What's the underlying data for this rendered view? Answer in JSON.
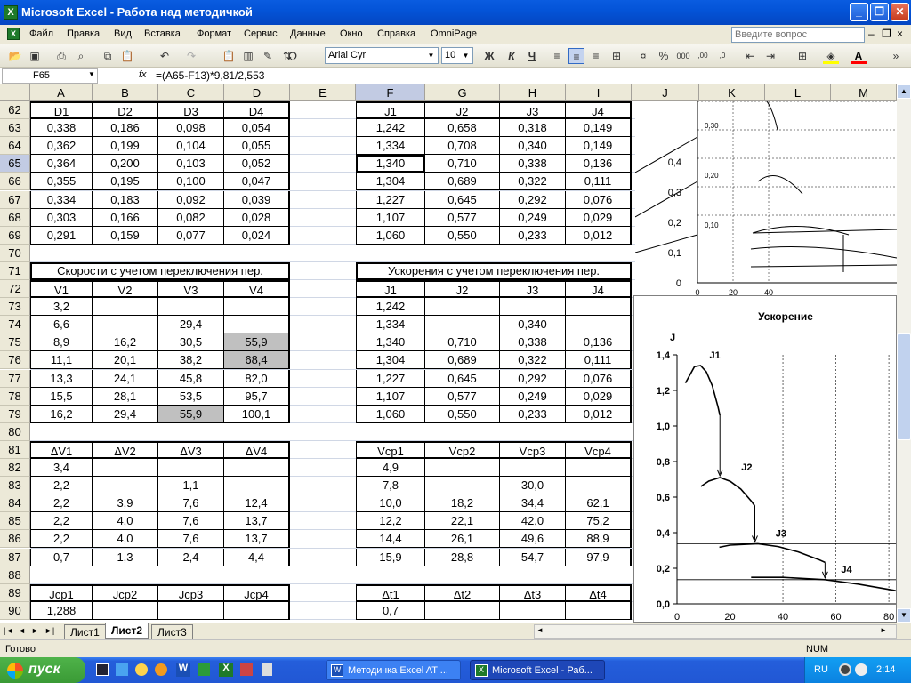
{
  "window": {
    "title": "Microsoft Excel - Работа над методичкой",
    "app_icon": "X"
  },
  "menu": [
    "Файл",
    "Правка",
    "Вид",
    "Вставка",
    "Формат",
    "Сервис",
    "Данные",
    "Окно",
    "Справка",
    "OmniPage"
  ],
  "help_box": {
    "placeholder": "Введите вопрос"
  },
  "toolbar": {
    "font": "Arial Cyr",
    "size": "10",
    "bold": "Ж",
    "italic": "К",
    "underline": "Ч"
  },
  "formula_bar": {
    "name_box": "F65",
    "fx": "fx",
    "formula": "=(A65-F13)*9,81/2,553"
  },
  "columns": [
    "A",
    "B",
    "C",
    "D",
    "E",
    "F",
    "G",
    "H",
    "I",
    "J",
    "K",
    "L",
    "M"
  ],
  "rows": {
    "r62": {
      "num": "62",
      "A": "D1",
      "B": "D2",
      "C": "D3",
      "D": "D4",
      "F": "J1",
      "G": "J2",
      "H": "J3",
      "I": "J4"
    },
    "r63": {
      "num": "63",
      "A": "0,338",
      "B": "0,186",
      "C": "0,098",
      "D": "0,054",
      "F": "1,242",
      "G": "0,658",
      "H": "0,318",
      "I": "0,149"
    },
    "r64": {
      "num": "64",
      "A": "0,362",
      "B": "0,199",
      "C": "0,104",
      "D": "0,055",
      "F": "1,334",
      "G": "0,708",
      "H": "0,340",
      "I": "0,149"
    },
    "r65": {
      "num": "65",
      "A": "0,364",
      "B": "0,200",
      "C": "0,103",
      "D": "0,052",
      "F": "1,340",
      "G": "0,710",
      "H": "0,338",
      "I": "0,136"
    },
    "r66": {
      "num": "66",
      "A": "0,355",
      "B": "0,195",
      "C": "0,100",
      "D": "0,047",
      "F": "1,304",
      "G": "0,689",
      "H": "0,322",
      "I": "0,111"
    },
    "r67": {
      "num": "67",
      "A": "0,334",
      "B": "0,183",
      "C": "0,092",
      "D": "0,039",
      "F": "1,227",
      "G": "0,645",
      "H": "0,292",
      "I": "0,076"
    },
    "r68": {
      "num": "68",
      "A": "0,303",
      "B": "0,166",
      "C": "0,082",
      "D": "0,028",
      "F": "1,107",
      "G": "0,577",
      "H": "0,249",
      "I": "0,029"
    },
    "r69": {
      "num": "69",
      "A": "0,291",
      "B": "0,159",
      "C": "0,077",
      "D": "0,024",
      "F": "1,060",
      "G": "0,550",
      "H": "0,233",
      "I": "0,012"
    },
    "r70": {
      "num": "70"
    },
    "r71": {
      "num": "71",
      "left": "Скорости с учетом переключения пер.",
      "right": "Ускорения с учетом переключения пер."
    },
    "r72": {
      "num": "72",
      "A": "V1",
      "B": "V2",
      "C": "V3",
      "D": "V4",
      "F": "J1",
      "G": "J2",
      "H": "J3",
      "I": "J4"
    },
    "r73": {
      "num": "73",
      "A": "3,2",
      "F": "1,242"
    },
    "r74": {
      "num": "74",
      "A": "6,6",
      "C": "29,4",
      "F": "1,334",
      "H": "0,340"
    },
    "r75": {
      "num": "75",
      "A": "8,9",
      "B": "16,2",
      "C": "30,5",
      "D": "55,9",
      "F": "1,340",
      "G": "0,710",
      "H": "0,338",
      "I": "0,136"
    },
    "r76": {
      "num": "76",
      "A": "11,1",
      "B": "20,1",
      "C": "38,2",
      "D": "68,4",
      "F": "1,304",
      "G": "0,689",
      "H": "0,322",
      "I": "0,111"
    },
    "r77": {
      "num": "77",
      "A": "13,3",
      "B": "24,1",
      "C": "45,8",
      "D": "82,0",
      "F": "1,227",
      "G": "0,645",
      "H": "0,292",
      "I": "0,076"
    },
    "r78": {
      "num": "78",
      "A": "15,5",
      "B": "28,1",
      "C": "53,5",
      "D": "95,7",
      "F": "1,107",
      "G": "0,577",
      "H": "0,249",
      "I": "0,029"
    },
    "r79": {
      "num": "79",
      "A": "16,2",
      "B": "29,4",
      "C": "55,9",
      "D": "100,1",
      "F": "1,060",
      "G": "0,550",
      "H": "0,233",
      "I": "0,012"
    },
    "r80": {
      "num": "80"
    },
    "r81": {
      "num": "81",
      "A": "ΔV1",
      "B": "ΔV2",
      "C": "ΔV3",
      "D": "ΔV4",
      "F": "Vcp1",
      "G": "Vcp2",
      "H": "Vcp3",
      "I": "Vcp4"
    },
    "r82": {
      "num": "82",
      "A": "3,4",
      "F": "4,9"
    },
    "r83": {
      "num": "83",
      "A": "2,2",
      "C": "1,1",
      "F": "7,8",
      "H": "30,0"
    },
    "r84": {
      "num": "84",
      "A": "2,2",
      "B": "3,9",
      "C": "7,6",
      "D": "12,4",
      "F": "10,0",
      "G": "18,2",
      "H": "34,4",
      "I": "62,1"
    },
    "r85": {
      "num": "85",
      "A": "2,2",
      "B": "4,0",
      "C": "7,6",
      "D": "13,7",
      "F": "12,2",
      "G": "22,1",
      "H": "42,0",
      "I": "75,2"
    },
    "r86": {
      "num": "86",
      "A": "2,2",
      "B": "4,0",
      "C": "7,6",
      "D": "13,7",
      "F": "14,4",
      "G": "26,1",
      "H": "49,6",
      "I": "88,9"
    },
    "r87": {
      "num": "87",
      "A": "0,7",
      "B": "1,3",
      "C": "2,4",
      "D": "4,4",
      "F": "15,9",
      "G": "28,8",
      "H": "54,7",
      "I": "97,9"
    },
    "r88": {
      "num": "88"
    },
    "r89": {
      "num": "89",
      "A": "Jcp1",
      "B": "Jcp2",
      "C": "Jcp3",
      "D": "Jcp4",
      "F": "Δt1",
      "G": "Δt2",
      "H": "Δt3",
      "I": "Δt4"
    },
    "r90": {
      "num": "90",
      "A": "1,288",
      "F": "0,7"
    }
  },
  "chart_top": {
    "yticks": [
      "0,4",
      "0,3",
      "0,2",
      "0,1",
      "0"
    ],
    "xticks": [
      "0",
      "20",
      "40"
    ],
    "inner": [
      "0,30",
      "0,20",
      "0,10"
    ]
  },
  "chart_data": {
    "type": "line",
    "title": "Ускорение",
    "ylabel": "J",
    "ylim": [
      0,
      1.4
    ],
    "xlim": [
      0,
      90
    ],
    "yticks": [
      "1,4",
      "1,2",
      "1,0",
      "0,8",
      "0,6",
      "0,4",
      "0,2",
      "0,0"
    ],
    "xticks": [
      "0",
      "20",
      "40",
      "60",
      "80"
    ],
    "series": [
      {
        "name": "J1",
        "x": [
          3.2,
          6.6,
          8.9,
          11.1,
          13.3,
          15.5,
          16.2
        ],
        "y": [
          1.242,
          1.334,
          1.34,
          1.304,
          1.227,
          1.107,
          1.06
        ]
      },
      {
        "name": "J2",
        "x": [
          9,
          12,
          16.2,
          20.1,
          24.1,
          28.1,
          29.4
        ],
        "y": [
          0.66,
          0.69,
          0.71,
          0.689,
          0.645,
          0.577,
          0.55
        ]
      },
      {
        "name": "J3",
        "x": [
          16,
          20,
          30.5,
          38.2,
          45.8,
          53.5,
          55.9
        ],
        "y": [
          0.318,
          0.33,
          0.338,
          0.322,
          0.292,
          0.249,
          0.233
        ]
      },
      {
        "name": "J4",
        "x": [
          28,
          40,
          55.9,
          68.4,
          82.0,
          95.7
        ],
        "y": [
          0.149,
          0.149,
          0.136,
          0.111,
          0.076,
          0.029
        ]
      }
    ]
  },
  "sheets": {
    "tab1": "Лист1",
    "tab2": "Лист2",
    "tab3": "Лист3"
  },
  "status": {
    "left": "Готово",
    "num": "NUM"
  },
  "taskbar": {
    "start": "пуск",
    "task1": "Методичка Excel AT ...",
    "task2": "Microsoft Excel - Раб...",
    "lang": "RU",
    "time": "2:14"
  }
}
